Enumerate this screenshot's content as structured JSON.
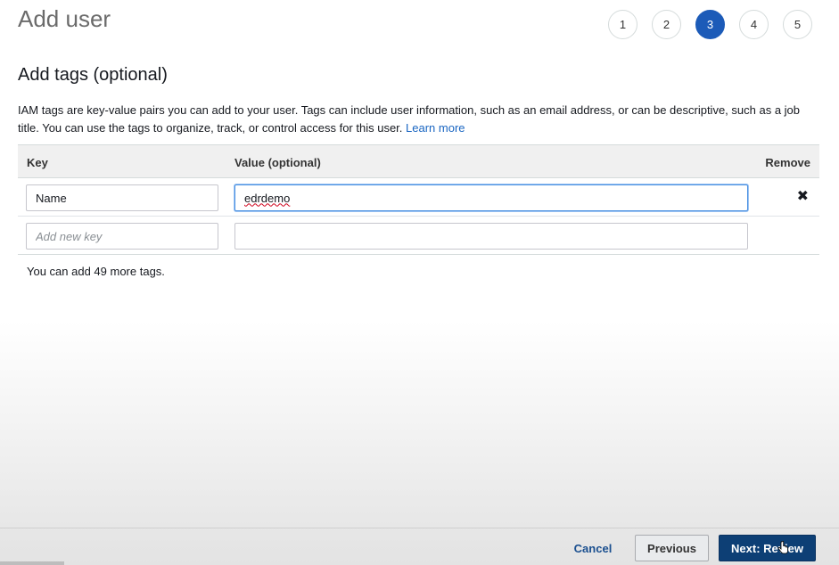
{
  "page": {
    "title": "Add user"
  },
  "steps": [
    {
      "label": "1",
      "active": false
    },
    {
      "label": "2",
      "active": false
    },
    {
      "label": "3",
      "active": true
    },
    {
      "label": "4",
      "active": false
    },
    {
      "label": "5",
      "active": false
    }
  ],
  "section": {
    "title": "Add tags (optional)",
    "description": "IAM tags are key-value pairs you can add to your user. Tags can include user information, such as an email address, or can be descriptive, such as a job title. You can use the tags to organize, track, or control access for this user.",
    "learn_more": "Learn more"
  },
  "table": {
    "headers": {
      "key": "Key",
      "value": "Value (optional)",
      "remove": "Remove"
    },
    "rows": [
      {
        "key": "Name",
        "value": "edrdemo"
      }
    ],
    "new_row": {
      "key_placeholder": "Add new key",
      "value": ""
    }
  },
  "tag_count_text": "You can add 49 more tags.",
  "footer": {
    "cancel": "Cancel",
    "previous": "Previous",
    "next": "Next: Review"
  },
  "colors": {
    "active_step": "#1c5bb8",
    "link": "#1a66c2",
    "primary_button": "#0d3f75"
  }
}
